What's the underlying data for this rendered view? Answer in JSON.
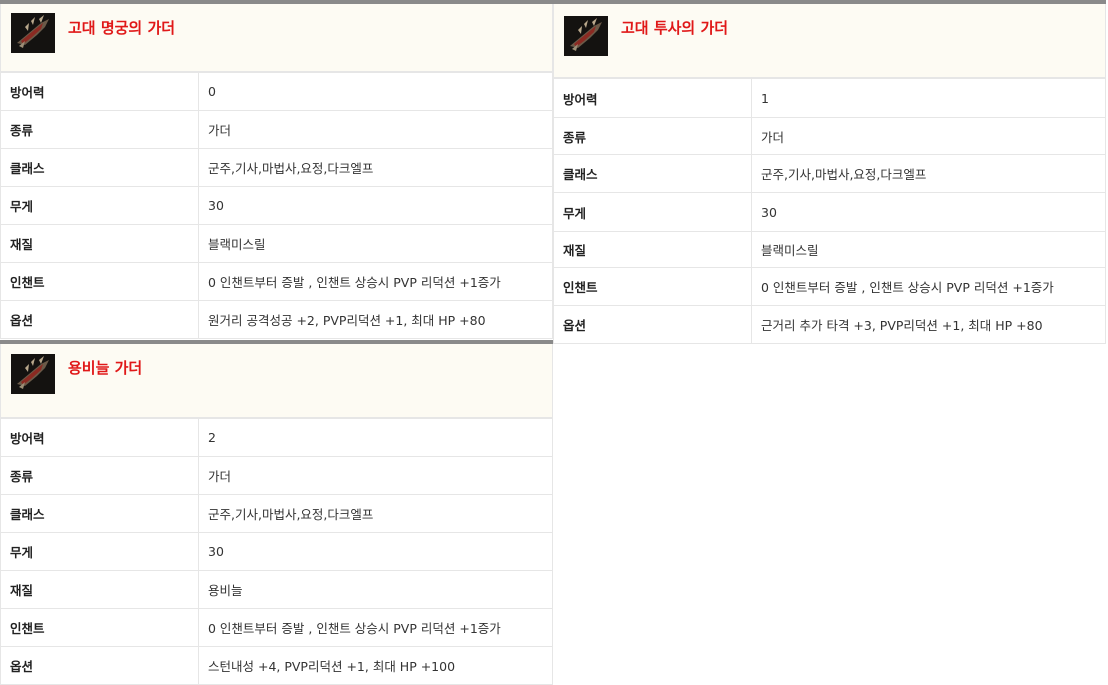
{
  "colors": {
    "title": "#e01818",
    "header_bg": "#fdfbf3",
    "top_border": "#8a8a8a",
    "grid": "#e6e6e6"
  },
  "items": [
    {
      "title": "고대 명궁의 가더",
      "icon": "guarder-item-icon",
      "rows": [
        {
          "label": "방어력",
          "value": "0"
        },
        {
          "label": "종류",
          "value": "가더"
        },
        {
          "label": "클래스",
          "value": "군주,기사,마법사,요정,다크엘프"
        },
        {
          "label": "무게",
          "value": "30"
        },
        {
          "label": "재질",
          "value": "블랙미스릴"
        },
        {
          "label": "인챈트",
          "value": "0 인챈트부터 증발 , 인챈트 상승시 PVP 리덕션 +1증가"
        },
        {
          "label": "옵션",
          "value": "원거리 공격성공 +2, PVP리덕션 +1, 최대 HP +80"
        }
      ]
    },
    {
      "title": "고대 투사의 가더",
      "icon": "guarder-item-icon",
      "rows": [
        {
          "label": "방어력",
          "value": "1"
        },
        {
          "label": "종류",
          "value": "가더"
        },
        {
          "label": "클래스",
          "value": "군주,기사,마법사,요정,다크엘프"
        },
        {
          "label": "무게",
          "value": "30"
        },
        {
          "label": "재질",
          "value": "블랙미스릴"
        },
        {
          "label": "인챈트",
          "value": "0 인챈트부터 증발 , 인챈트 상승시 PVP 리덕션 +1증가"
        },
        {
          "label": "옵션",
          "value": "근거리 추가 타격 +3, PVP리덕션 +1, 최대 HP +80"
        }
      ]
    },
    {
      "title": "용비늘 가더",
      "icon": "guarder-item-icon",
      "rows": [
        {
          "label": "방어력",
          "value": "2"
        },
        {
          "label": "종류",
          "value": "가더"
        },
        {
          "label": "클래스",
          "value": "군주,기사,마법사,요정,다크엘프"
        },
        {
          "label": "무게",
          "value": "30"
        },
        {
          "label": "재질",
          "value": "용비늘"
        },
        {
          "label": "인챈트",
          "value": "0 인챈트부터 증발 , 인챈트 상승시 PVP 리덕션 +1증가"
        },
        {
          "label": "옵션",
          "value": "스턴내성 +4, PVP리덕션 +1, 최대 HP +100"
        }
      ]
    }
  ]
}
